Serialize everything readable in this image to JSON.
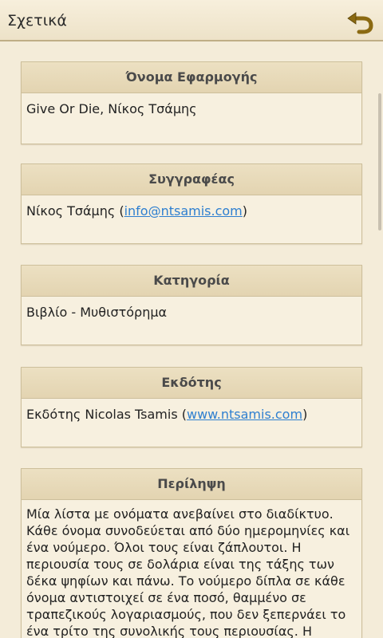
{
  "appbar": {
    "title": "Σχετικά"
  },
  "colors": {
    "background": "#f4ecd9",
    "accent": "#8b6a12",
    "link": "#2e7fd0"
  },
  "icons": {
    "back": "back-arrow-icon"
  },
  "sections": {
    "app_name": {
      "header": "Όνομα Εφαρμογής",
      "body": "Give Or Die, Νίκος Τσάμης"
    },
    "author": {
      "header": "Συγγραφέας",
      "prefix": "Νίκος Τσάμης (",
      "link": "info@ntsamis.com",
      "suffix": ")"
    },
    "category": {
      "header": "Κατηγορία",
      "body": "Βιβλίο - Μυθιστόρημα"
    },
    "publisher": {
      "header": "Εκδότης",
      "prefix": "Εκδότης Nicolas Tsamis (",
      "link": "www.ntsamis.com",
      "suffix": ")"
    },
    "summary": {
      "header": "Περίληψη",
      "body": "Μία λίστα με ονόματα ανεβαίνει στο διαδίκτυο. Κάθε όνομα συνοδεύεται από δύο ημερομηνίες και ένα νούμερο. Όλοι τους είναι ζάπλουτοι. Η περιουσία τους σε δολάρια είναι της τάξης των δέκα ψηφίων και πάνω. Το νούμερο δίπλα σε κάθε όνομα αντιστοιχεί σε ένα ποσό, θαμμένο σε τραπεζικούς λογαριασμούς, που δεν ξεπερνάει το ένα τρίτο της συνολικής τους περιουσίας. Η"
    }
  }
}
